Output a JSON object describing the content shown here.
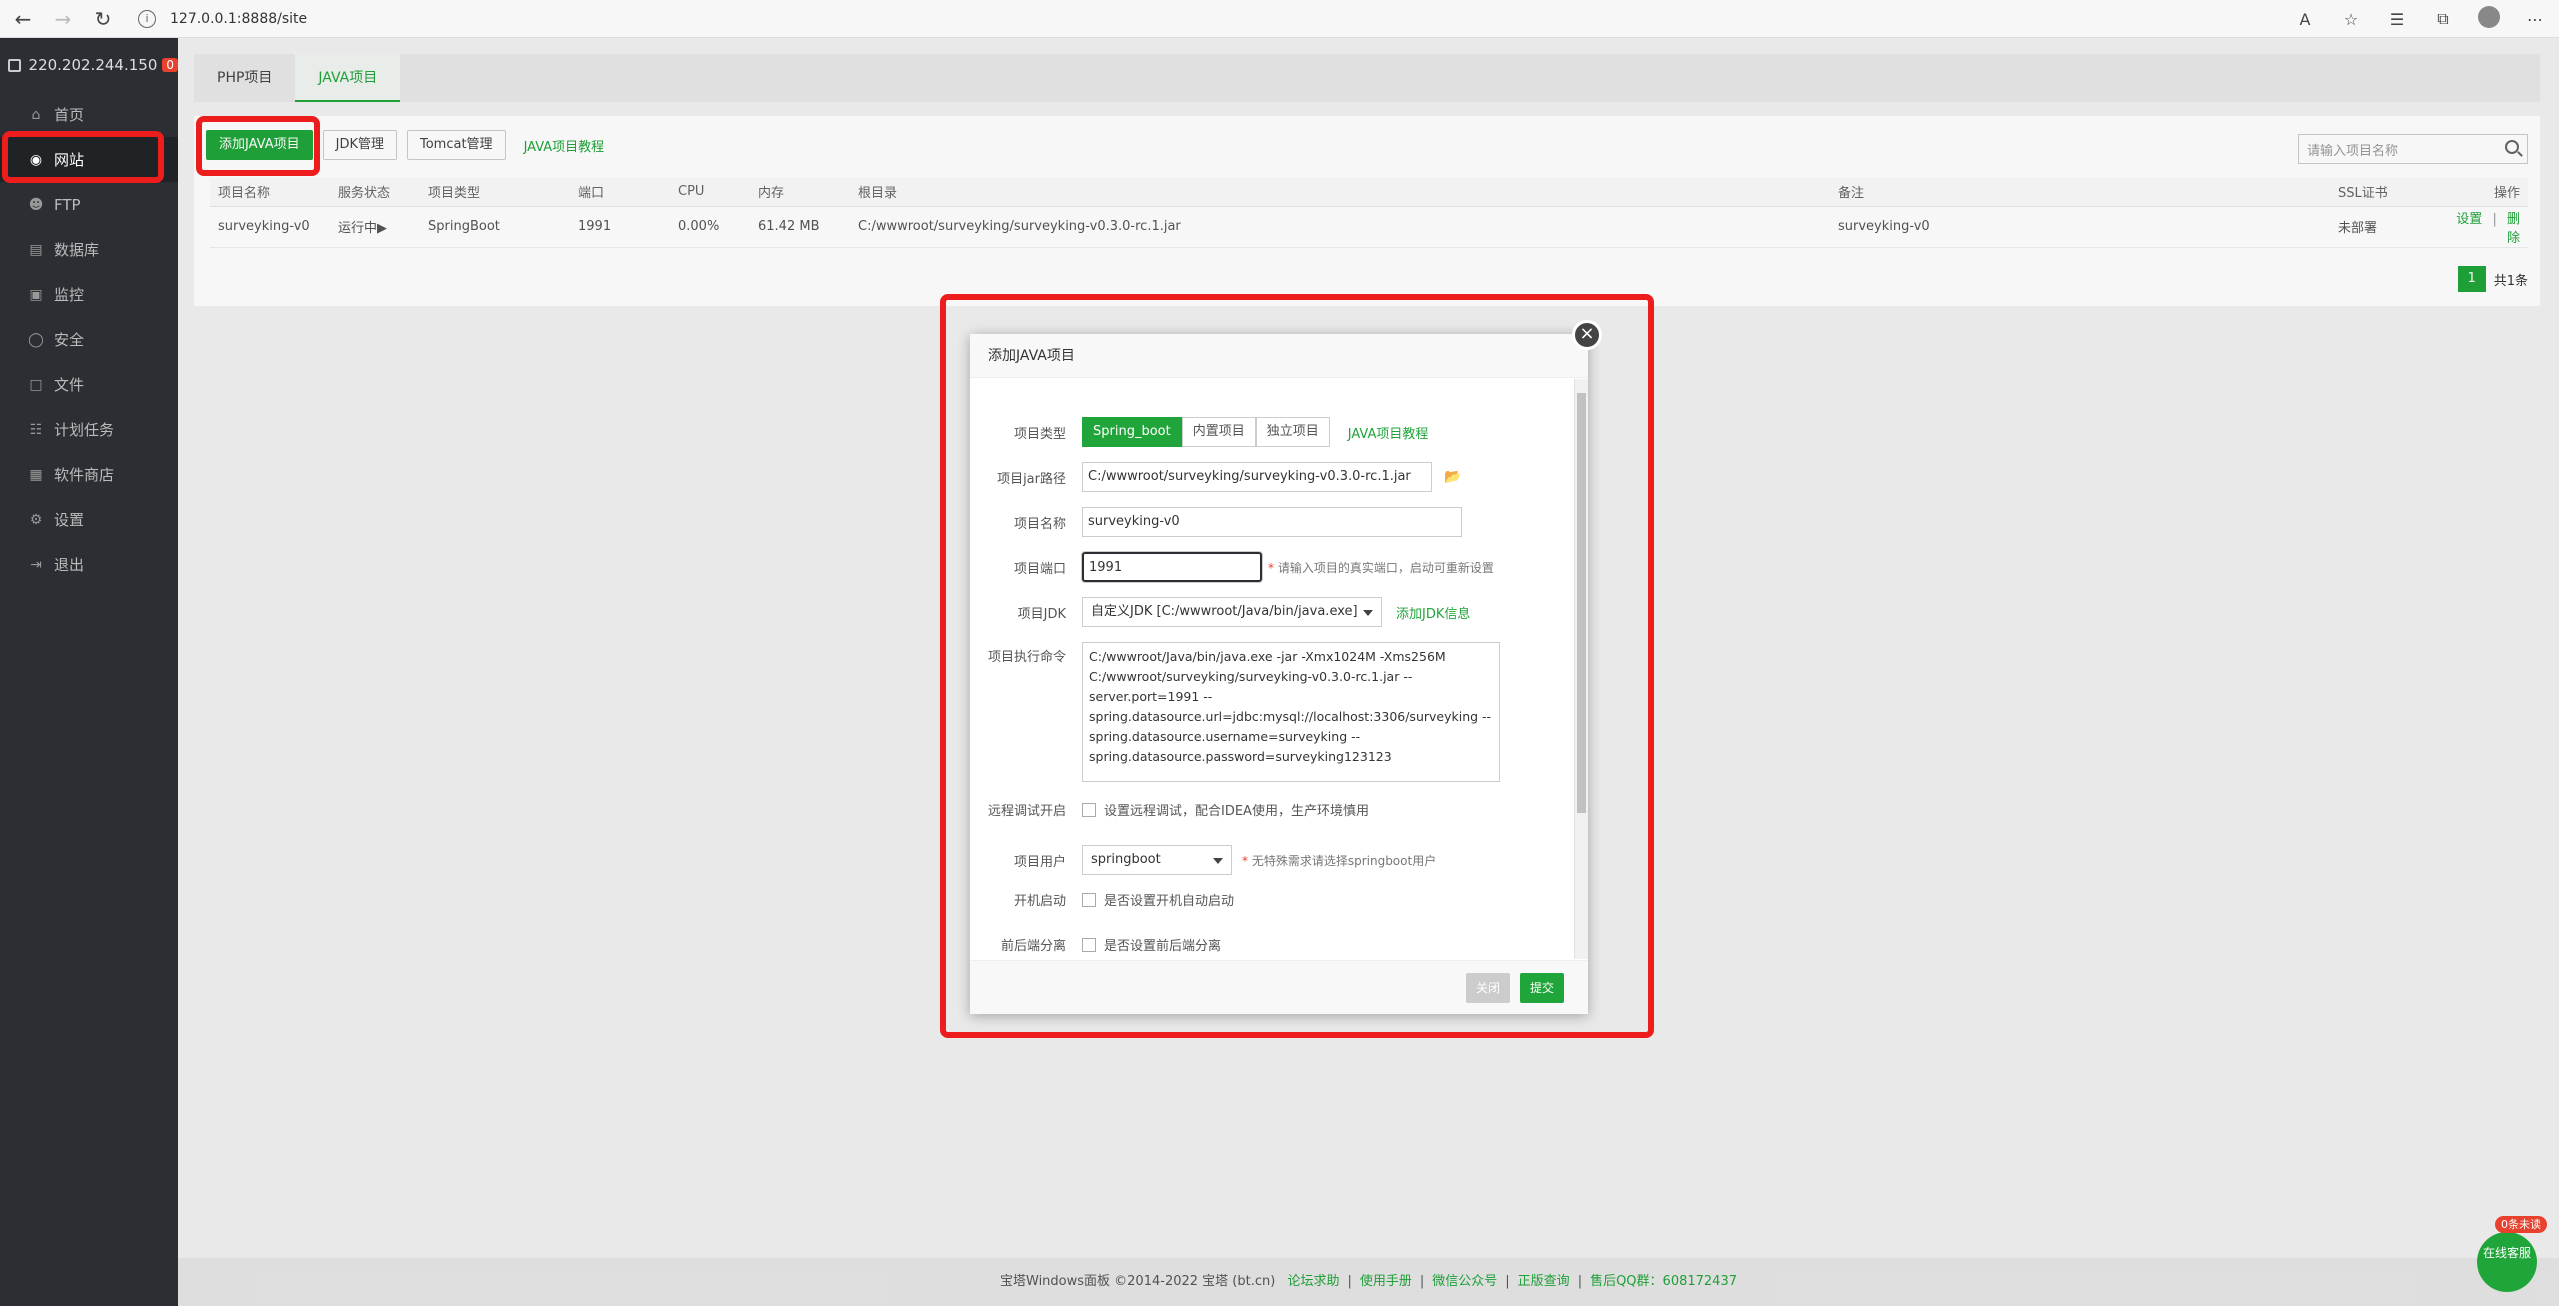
{
  "browser": {
    "url": "127.0.0.1:8888/site"
  },
  "sidebar": {
    "server_ip": "220.202.244.150",
    "server_badge": "0",
    "items": [
      {
        "label": "首页",
        "icon": "home-icon"
      },
      {
        "label": "网站",
        "icon": "globe-icon"
      },
      {
        "label": "FTP",
        "icon": "ftp-icon"
      },
      {
        "label": "数据库",
        "icon": "database-icon"
      },
      {
        "label": "监控",
        "icon": "monitor-icon"
      },
      {
        "label": "安全",
        "icon": "shield-icon"
      },
      {
        "label": "文件",
        "icon": "folder-icon"
      },
      {
        "label": "计划任务",
        "icon": "task-icon"
      },
      {
        "label": "软件商店",
        "icon": "store-icon"
      },
      {
        "label": "设置",
        "icon": "gear-icon"
      },
      {
        "label": "退出",
        "icon": "logout-icon"
      }
    ]
  },
  "tabs": [
    {
      "label": "PHP项目"
    },
    {
      "label": "JAVA项目"
    }
  ],
  "toolbar": {
    "add_java": "添加JAVA项目",
    "jdk": "JDK管理",
    "tomcat": "Tomcat管理",
    "tutorial": "JAVA项目教程",
    "search_placeholder": "请输入项目名称"
  },
  "table": {
    "headers": [
      "项目名称",
      "服务状态",
      "项目类型",
      "端口",
      "CPU",
      "内存",
      "根目录",
      "备注",
      "SSL证书",
      "操作"
    ],
    "rows": [
      {
        "name": "surveyking-v0",
        "status": "运行中▶",
        "type": "SpringBoot",
        "port": "1991",
        "cpu": "0.00%",
        "mem": "61.42 MB",
        "root": "C:/wwwroot/surveyking/surveyking-v0.3.0-rc.1.jar",
        "remark": "surveyking-v0",
        "ssl": "未部署",
        "op_settings": "设置",
        "op_sep": "|",
        "op_delete": "删除"
      }
    ]
  },
  "pager": {
    "page": "1",
    "total": "共1条"
  },
  "modal": {
    "title": "添加JAVA项目",
    "type_label": "项目类型",
    "type_options": [
      "Spring_boot",
      "内置项目",
      "独立项目"
    ],
    "type_tutorial": "JAVA项目教程",
    "jar_label": "项目jar路径",
    "jar_value": "C:/wwwroot/surveyking/surveyking-v0.3.0-rc.1.jar",
    "name_label": "项目名称",
    "name_value": "surveyking-v0",
    "port_label": "项目端口",
    "port_value": "1991",
    "port_hint": "请输入项目的真实端口，启动可重新设置",
    "jdk_label": "项目JDK",
    "jdk_value": "自定义JDK [C:/wwwroot/Java/bin/java.exe]",
    "jdk_add": "添加JDK信息",
    "cmd_label": "项目执行命令",
    "cmd_value": "C:/wwwroot/Java/bin/java.exe -jar -Xmx1024M -Xms256M C:/wwwroot/surveyking/surveyking-v0.3.0-rc.1.jar --server.port=1991 --spring.datasource.url=jdbc:mysql://localhost:3306/surveyking --spring.datasource.username=surveyking --spring.datasource.password=surveyking123123",
    "debug_label": "远程调试开启",
    "debug_text": "设置远程调试，配合IDEA使用，生产环境慎用",
    "user_label": "项目用户",
    "user_value": "springboot",
    "user_hint": "无特殊需求请选择springboot用户",
    "autostart_label": "开机启动",
    "autostart_text": "是否设置开机自动启动",
    "split_label": "前后端分离",
    "split_text": "是否设置前后端分离",
    "close_btn": "关闭",
    "submit_btn": "提交"
  },
  "footer": {
    "copyright": "宝塔Windows面板 ©2014-2022 宝塔 (bt.cn)",
    "links": [
      "论坛求助",
      "使用手册",
      "微信公众号",
      "正版查询"
    ],
    "qq": "售后QQ群：608172437"
  },
  "chat": {
    "badge": "0条未读",
    "label": "在线客服"
  }
}
